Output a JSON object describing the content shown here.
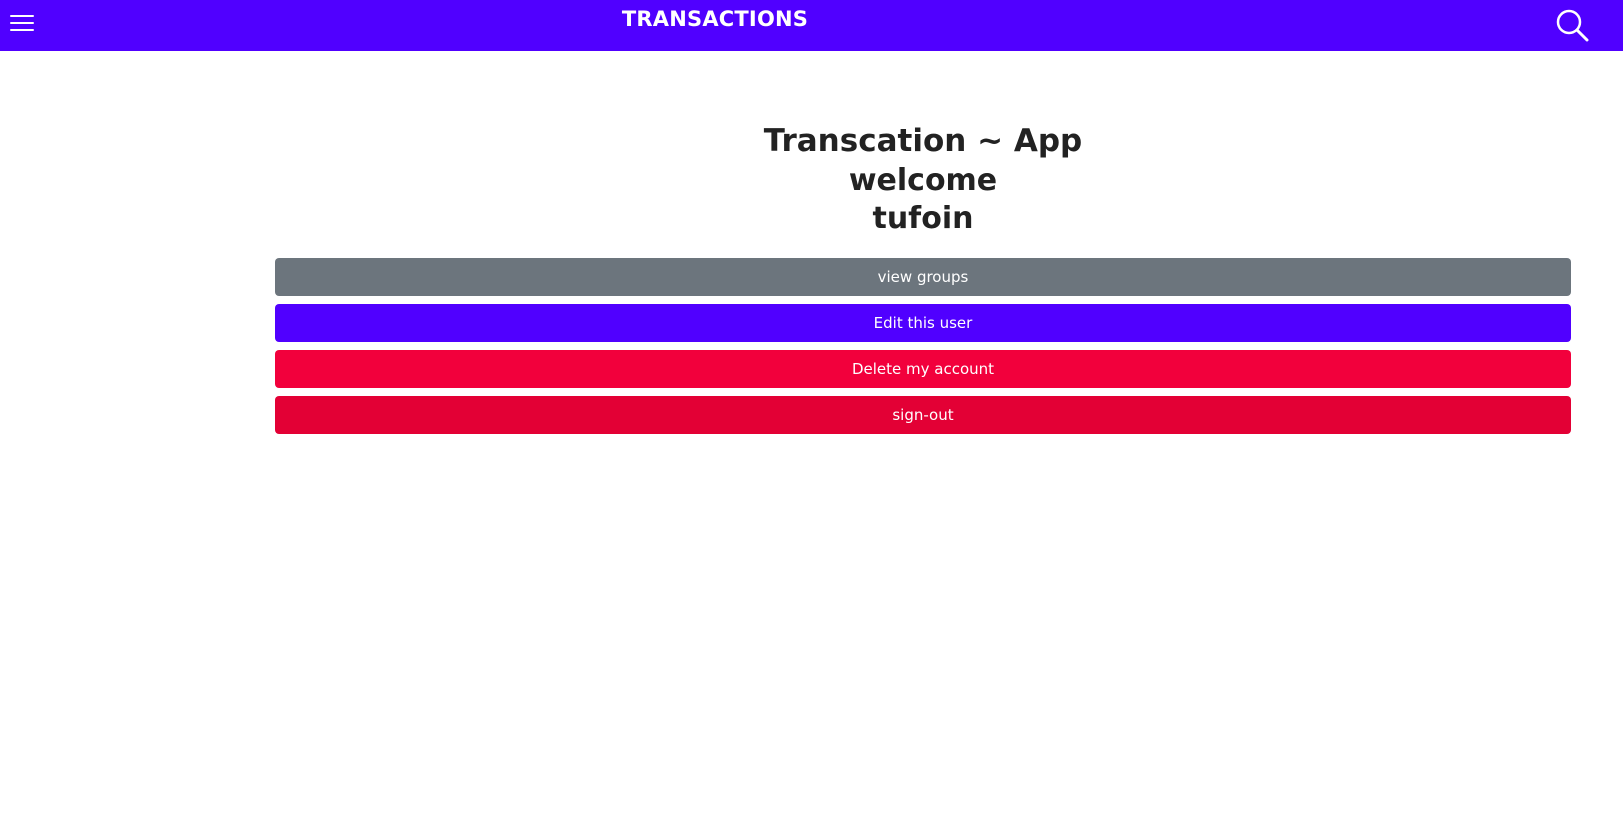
{
  "navbar": {
    "title": "TRANSACTIONS",
    "menu_icon": "menu-icon",
    "search_icon": "search-icon",
    "background_color": "#5000ff"
  },
  "main": {
    "app_title": "Transcation ~ App",
    "welcome_text": "welcome",
    "username": "tufoin"
  },
  "actions": {
    "view_groups_label": "view groups",
    "edit_user_label": "Edit this user",
    "delete_account_label": "Delete my account",
    "sign_out_label": "sign-out"
  },
  "colors": {
    "primary": "#5000ff",
    "secondary": "#6c757d",
    "danger": "#f2003c",
    "danger_dark": "#e30035"
  }
}
